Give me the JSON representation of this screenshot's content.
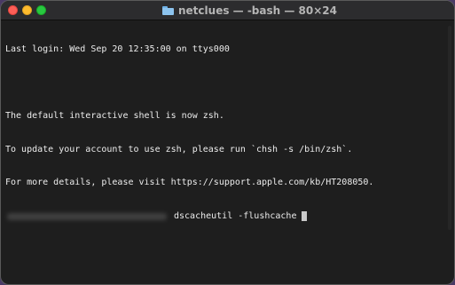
{
  "window": {
    "title": "netclues — -bash — 80×24"
  },
  "icons": {
    "title_icon": "folder-icon",
    "close": "close-button-icon",
    "minimize": "minimize-button-icon",
    "zoom": "zoom-button-icon"
  },
  "terminal": {
    "lines": [
      "Last login: Wed Sep 20 12:35:00 on ttys000",
      "",
      "The default interactive shell is now zsh.",
      "To update your account to use zsh, please run `chsh -s /bin/zsh`.",
      "For more details, please visit https://support.apple.com/kb/HT208050."
    ],
    "command": "dscacheutil -flushcache"
  },
  "colors": {
    "background": "#1e1e1e",
    "text": "#ececec",
    "close": "#fe5f57",
    "minimize": "#febc2e",
    "zoom": "#28c840"
  }
}
